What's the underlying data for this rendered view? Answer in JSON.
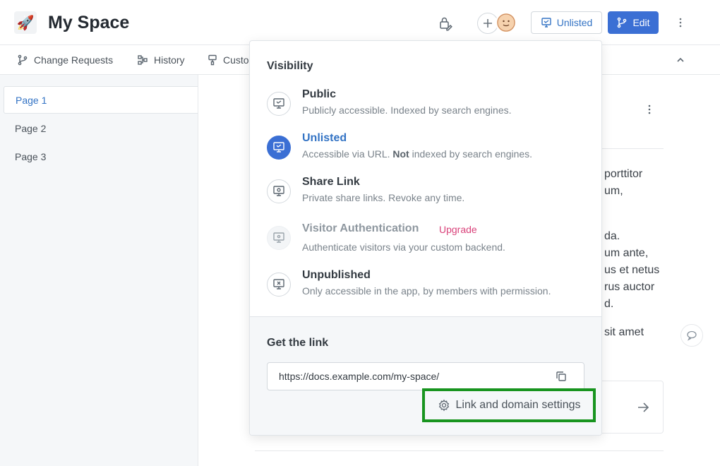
{
  "header": {
    "logo_glyph": "🚀",
    "title": "My Space",
    "unlisted_label": "Unlisted",
    "edit_label": "Edit"
  },
  "tabs": [
    {
      "label": "Change Requests",
      "icon": "branch-icon"
    },
    {
      "label": "History",
      "icon": "history-icon"
    },
    {
      "label": "Custo",
      "icon": "brush-icon"
    }
  ],
  "sidebar": {
    "items": [
      {
        "label": "Page 1",
        "active": true
      },
      {
        "label": "Page 2",
        "active": false
      },
      {
        "label": "Page 3",
        "active": false
      }
    ]
  },
  "main": {
    "visible_text": [
      "porttitor",
      "um,",
      "da.",
      "um ante,",
      "us et netus",
      "rus auctor",
      "d.",
      "sit amet"
    ]
  },
  "popover": {
    "heading": "Visibility",
    "options": [
      {
        "title": "Public",
        "desc": "Publicly accessible. Indexed by search engines.",
        "state": "normal"
      },
      {
        "title": "Unlisted",
        "desc_pre": "Accessible via URL. ",
        "desc_bold": "Not",
        "desc_post": " indexed by search engines.",
        "state": "selected"
      },
      {
        "title": "Share Link",
        "desc": "Private share links. Revoke any time.",
        "state": "normal"
      },
      {
        "title": "Visitor Authentication",
        "badge": "Upgrade",
        "desc": "Authenticate visitors via your custom backend.",
        "state": "disabled"
      },
      {
        "title": "Unpublished",
        "desc": "Only accessible in the app, by members with permission.",
        "state": "normal"
      }
    ],
    "footer": {
      "heading": "Get the link",
      "link_url": "https://docs.example.com/my-space/",
      "settings_label": "Link and domain settings"
    }
  },
  "colors": {
    "accent": "#3b6fd4",
    "link": "#3373c4",
    "badge": "#d9427a",
    "highlight": "#18941f"
  }
}
